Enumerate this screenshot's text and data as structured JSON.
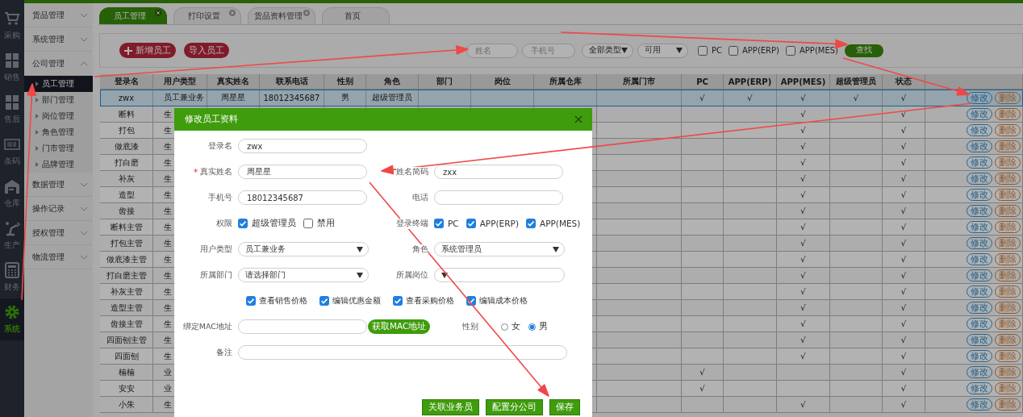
{
  "nav": [
    {
      "label": "采购",
      "kind": "cart",
      "selected": false
    },
    {
      "label": "销售",
      "kind": "boxes",
      "selected": false
    },
    {
      "label": "售后",
      "kind": "boxes",
      "selected": false
    },
    {
      "label": "条码",
      "kind": "barcode",
      "selected": false
    },
    {
      "label": "仓库",
      "kind": "warehouse",
      "selected": false
    },
    {
      "label": "生产",
      "kind": "robot",
      "selected": false
    },
    {
      "label": "财务",
      "kind": "calculator",
      "selected": false
    },
    {
      "label": "系统",
      "kind": "gear",
      "selected": true
    }
  ],
  "menu": [
    {
      "label": "货品管理",
      "expanded": false
    },
    {
      "label": "系统管理",
      "expanded": false
    },
    {
      "label": "公司管理",
      "expanded": true,
      "children": [
        {
          "label": "员工管理",
          "selected": true
        },
        {
          "label": "部门管理",
          "selected": false
        },
        {
          "label": "岗位管理",
          "selected": false
        },
        {
          "label": "角色管理",
          "selected": false
        },
        {
          "label": "门市管理",
          "selected": false
        },
        {
          "label": "品牌管理",
          "selected": false
        }
      ]
    },
    {
      "label": "数据管理",
      "expanded": false
    },
    {
      "label": "操作记录",
      "expanded": false
    },
    {
      "label": "授权管理",
      "expanded": false
    },
    {
      "label": "物流管理",
      "expanded": false
    }
  ],
  "tabs": [
    {
      "label": "员工管理",
      "selected": true,
      "closable": true
    },
    {
      "label": "打印设置",
      "selected": false,
      "closable": true
    },
    {
      "label": "货品资料管理",
      "selected": false,
      "closable": true
    },
    {
      "label": "首页",
      "selected": false,
      "closable": false
    }
  ],
  "toolbar": {
    "buttons": [
      {
        "label": "新增员工",
        "kind": "add"
      },
      {
        "label": "导入员工",
        "kind": "import"
      }
    ],
    "name_field": {
      "placeholder": "姓名"
    },
    "phone_field": {
      "placeholder": "手机号"
    },
    "type_select": {
      "value": "全部类型"
    },
    "status_select": {
      "value": "可用"
    },
    "filters": [
      {
        "label": "PC",
        "checked": false
      },
      {
        "label": "APP(ERP)",
        "checked": false
      },
      {
        "label": "APP(MES)",
        "checked": false
      }
    ],
    "search_button": "查找"
  },
  "table": {
    "columns": [
      "登录名",
      "用户类型",
      "真实姓名",
      "联系电话",
      "性别",
      "角色",
      "部门",
      "岗位",
      "所属仓库",
      "所属门市",
      "PC",
      "APP(ERP)",
      "APP(MES)",
      "超级管理员",
      "状态"
    ],
    "rows": [
      {
        "selected": true,
        "login_name": "zwx",
        "user_type": "员工兼业务",
        "real_name": "周星星",
        "phone": "18012345687",
        "gender": "男",
        "role": "超级管理员",
        "pc": "√",
        "app_erp": "√",
        "app_mes": "√",
        "super_admin": "√",
        "status": "√",
        "actions": [
          "修改",
          "删除"
        ]
      },
      {
        "selected": false,
        "login_name": "断料",
        "user_type": "生",
        "app_mes": "√",
        "status": "√",
        "actions": [
          "修改",
          "删除"
        ]
      },
      {
        "selected": false,
        "login_name": "打包",
        "user_type": "生",
        "app_mes": "√",
        "status": "√",
        "actions": [
          "修改",
          "删除"
        ]
      },
      {
        "selected": false,
        "login_name": "做底漆",
        "user_type": "生",
        "app_mes": "√",
        "status": "√",
        "actions": [
          "修改",
          "删除"
        ]
      },
      {
        "selected": false,
        "login_name": "打白磨",
        "user_type": "生",
        "app_mes": "√",
        "status": "√",
        "actions": [
          "修改",
          "删除"
        ]
      },
      {
        "selected": false,
        "login_name": "补灰",
        "user_type": "生",
        "app_mes": "√",
        "status": "√",
        "actions": [
          "修改",
          "删除"
        ]
      },
      {
        "selected": false,
        "login_name": "造型",
        "user_type": "生",
        "app_mes": "√",
        "status": "√",
        "actions": [
          "修改",
          "删除"
        ]
      },
      {
        "selected": false,
        "login_name": "齿接",
        "user_type": "生",
        "app_mes": "√",
        "status": "√",
        "actions": [
          "修改",
          "删除"
        ]
      },
      {
        "selected": false,
        "login_name": "断料主管",
        "user_type": "生",
        "app_mes": "√",
        "status": "√",
        "actions": [
          "修改",
          "删除"
        ]
      },
      {
        "selected": false,
        "login_name": "打包主管",
        "user_type": "生",
        "app_mes": "√",
        "status": "√",
        "actions": [
          "修改",
          "删除"
        ]
      },
      {
        "selected": false,
        "login_name": "做底漆主管",
        "user_type": "生",
        "app_mes": "√",
        "status": "√",
        "actions": [
          "修改",
          "删除"
        ]
      },
      {
        "selected": false,
        "login_name": "打白磨主管",
        "user_type": "生",
        "app_mes": "√",
        "status": "√",
        "actions": [
          "修改",
          "删除"
        ]
      },
      {
        "selected": false,
        "login_name": "补灰主管",
        "user_type": "生",
        "app_mes": "√",
        "status": "√",
        "actions": [
          "修改",
          "删除"
        ]
      },
      {
        "selected": false,
        "login_name": "造型主管",
        "user_type": "生",
        "app_mes": "√",
        "status": "√",
        "actions": [
          "修改",
          "删除"
        ]
      },
      {
        "selected": false,
        "login_name": "齿接主管",
        "user_type": "生",
        "app_mes": "√",
        "status": "√",
        "actions": [
          "修改",
          "删除"
        ]
      },
      {
        "selected": false,
        "login_name": "四面刨主管",
        "user_type": "生",
        "app_mes": "√",
        "status": "√",
        "actions": [
          "修改",
          "删除"
        ]
      },
      {
        "selected": false,
        "login_name": "四面刨",
        "user_type": "生",
        "app_mes": "√",
        "status": "√",
        "actions": [
          "修改",
          "删除"
        ]
      },
      {
        "selected": false,
        "login_name": "楠楠",
        "user_type": "业",
        "pc": "√",
        "status": "√",
        "actions": [
          "修改",
          "删除"
        ]
      },
      {
        "selected": false,
        "login_name": "安安",
        "user_type": "业",
        "pc": "√",
        "status": "√",
        "actions": [
          "修改",
          "删除"
        ]
      },
      {
        "selected": false,
        "login_name": "小朱",
        "user_type": "生",
        "app_mes": "√",
        "status": "√",
        "actions": [
          "修改",
          "删除"
        ]
      }
    ]
  },
  "dialog": {
    "title": "修改员工资料",
    "rows": [
      [
        {
          "kind": "input",
          "label": "登录名",
          "value": "zwx"
        }
      ],
      [
        {
          "kind": "input",
          "label": "真实姓名",
          "marker": "*",
          "value": "周星星"
        },
        {
          "kind": "input",
          "label": "姓名简码",
          "value": "zxx"
        }
      ],
      [
        {
          "kind": "input",
          "label": "手机号",
          "value": "18012345687"
        },
        {
          "kind": "input",
          "label": "电话"
        }
      ],
      [
        {
          "kind": "checks",
          "label": "权限",
          "options": [
            {
              "label": "超级管理员",
              "checked": true
            },
            {
              "label": "禁用",
              "checked": false
            }
          ]
        },
        {
          "kind": "checks",
          "label": "登录终端",
          "options": [
            {
              "label": "PC",
              "checked": true
            },
            {
              "label": "APP(ERP)",
              "checked": true
            },
            {
              "label": "APP(MES)",
              "checked": true
            }
          ]
        }
      ],
      [
        {
          "kind": "select",
          "label": "用户类型",
          "value": "员工兼业务"
        },
        {
          "kind": "select",
          "label": "角色",
          "value": "系统管理员"
        }
      ],
      [
        {
          "kind": "select",
          "label": "所属部门",
          "value": "请选择部门"
        },
        {
          "kind": "select",
          "label": "所属岗位"
        }
      ]
    ],
    "permissions": [
      {
        "label": "查看销售价格",
        "checked": true
      },
      {
        "label": "编辑优惠金额",
        "checked": true
      },
      {
        "label": "查看采购价格",
        "checked": true
      },
      {
        "label": "编辑成本价格",
        "checked": true
      }
    ],
    "mac": {
      "label": "绑定MAC地址",
      "button": "获取MAC地址"
    },
    "gender": {
      "label": "性别",
      "options": [
        {
          "label": "女",
          "selected": false
        },
        {
          "label": "男",
          "selected": true
        }
      ]
    },
    "remark": {
      "label": "备注"
    },
    "buttons": [
      "关联业务员",
      "配置分公司",
      "保存"
    ]
  }
}
